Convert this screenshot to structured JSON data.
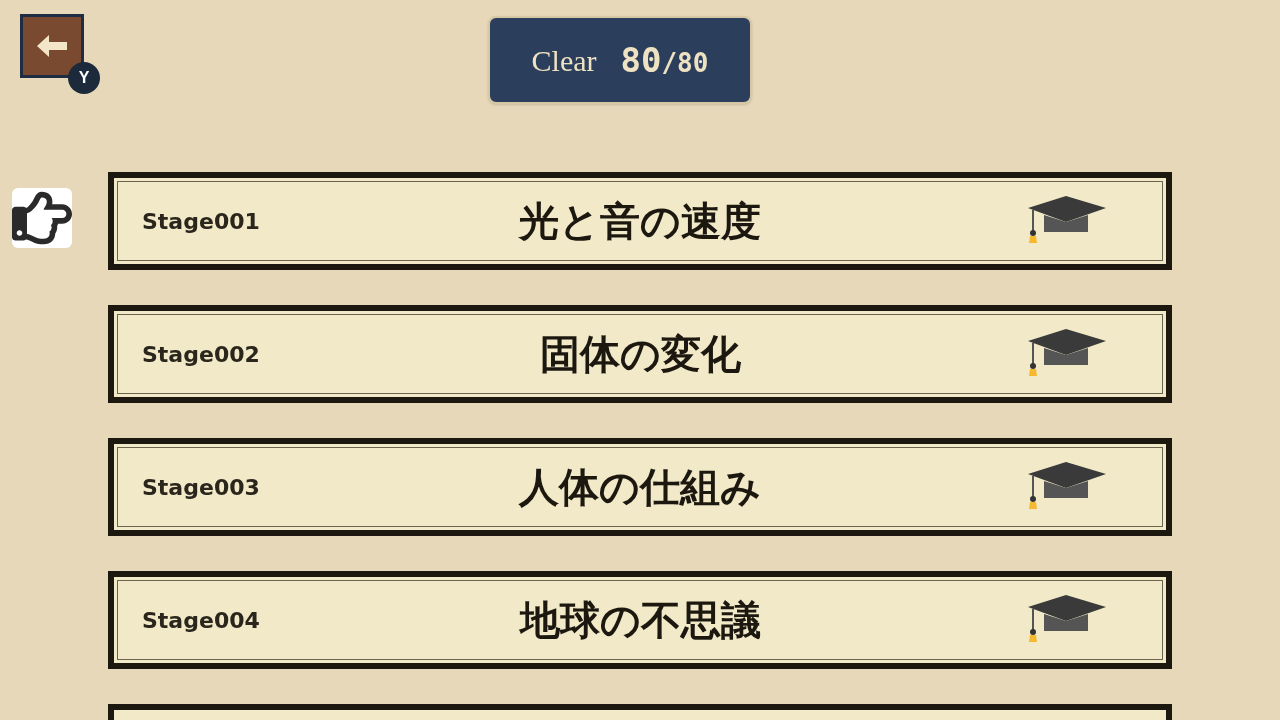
{
  "back_button": {
    "key_hint": "Y"
  },
  "progress": {
    "label": "Clear",
    "cleared": "80",
    "total": "/80"
  },
  "stages": [
    {
      "number": "Stage001",
      "title": "光と音の速度",
      "cleared": true,
      "selected": true
    },
    {
      "number": "Stage002",
      "title": "固体の変化",
      "cleared": true,
      "selected": false
    },
    {
      "number": "Stage003",
      "title": "人体の仕組み",
      "cleared": true,
      "selected": false
    },
    {
      "number": "Stage004",
      "title": "地球の不思議",
      "cleared": true,
      "selected": false
    }
  ]
}
